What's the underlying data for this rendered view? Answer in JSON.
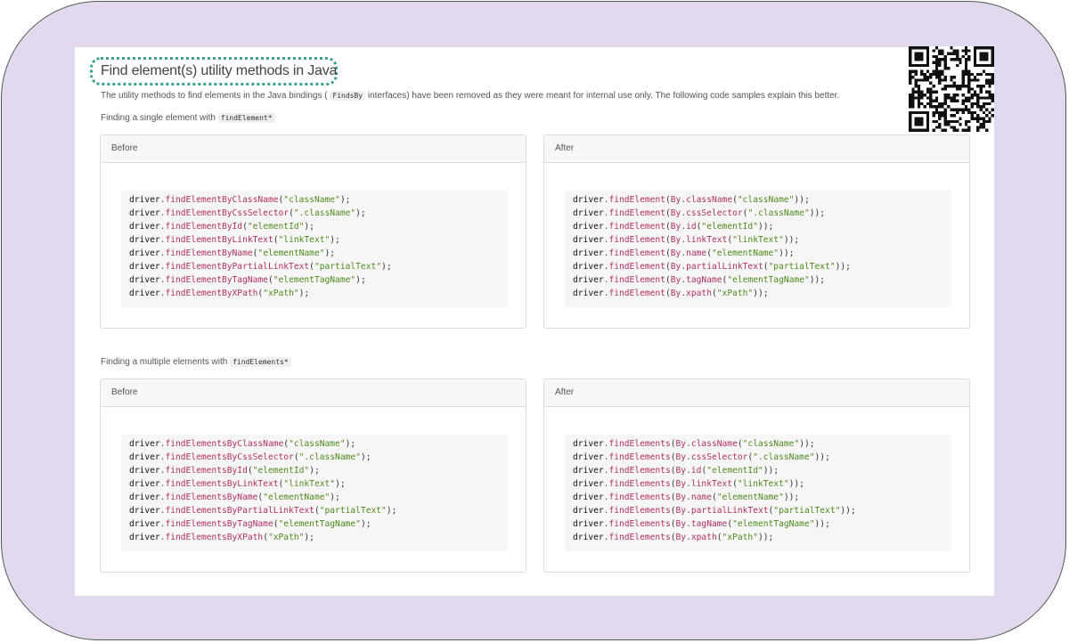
{
  "title": "Find element(s) utility methods in Java",
  "intro": {
    "before": "The utility methods to find elements in the Java bindings (",
    "code": "FindsBy",
    "after": "interfaces) have been removed as they were meant for internal use only. The following code samples explain this better."
  },
  "sections": [
    {
      "heading_text": "Finding a single element with",
      "heading_code": "findElement*",
      "before": {
        "header": "Before",
        "lines": [
          {
            "method": "findElementByClassName",
            "arg": "\"className\"",
            "wrap": ""
          },
          {
            "method": "findElementByCssSelector",
            "arg": "\".className\"",
            "wrap": ""
          },
          {
            "method": "findElementById",
            "arg": "\"elementId\"",
            "wrap": ""
          },
          {
            "method": "findElementByLinkText",
            "arg": "\"linkText\"",
            "wrap": ""
          },
          {
            "method": "findElementByName",
            "arg": "\"elementName\"",
            "wrap": ""
          },
          {
            "method": "findElementByPartialLinkText",
            "arg": "\"partialText\"",
            "wrap": ""
          },
          {
            "method": "findElementByTagName",
            "arg": "\"elementTagName\"",
            "wrap": ""
          },
          {
            "method": "findElementByXPath",
            "arg": "\"xPath\"",
            "wrap": ""
          }
        ]
      },
      "after": {
        "header": "After",
        "lines": [
          {
            "method": "findElement",
            "wrap": "By.className",
            "arg": "\"className\""
          },
          {
            "method": "findElement",
            "wrap": "By.cssSelector",
            "arg": "\".className\""
          },
          {
            "method": "findElement",
            "wrap": "By.id",
            "arg": "\"elementId\""
          },
          {
            "method": "findElement",
            "wrap": "By.linkText",
            "arg": "\"linkText\""
          },
          {
            "method": "findElement",
            "wrap": "By.name",
            "arg": "\"elementName\""
          },
          {
            "method": "findElement",
            "wrap": "By.partialLinkText",
            "arg": "\"partialText\""
          },
          {
            "method": "findElement",
            "wrap": "By.tagName",
            "arg": "\"elementTagName\""
          },
          {
            "method": "findElement",
            "wrap": "By.xpath",
            "arg": "\"xPath\""
          }
        ]
      }
    },
    {
      "heading_text": "Finding a multiple elements with",
      "heading_code": "findElements*",
      "before": {
        "header": "Before",
        "lines": [
          {
            "method": "findElementsByClassName",
            "arg": "\"className\"",
            "wrap": ""
          },
          {
            "method": "findElementsByCssSelector",
            "arg": "\".className\"",
            "wrap": ""
          },
          {
            "method": "findElementsById",
            "arg": "\"elementId\"",
            "wrap": ""
          },
          {
            "method": "findElementsByLinkText",
            "arg": "\"linkText\"",
            "wrap": ""
          },
          {
            "method": "findElementsByName",
            "arg": "\"elementName\"",
            "wrap": ""
          },
          {
            "method": "findElementsByPartialLinkText",
            "arg": "\"partialText\"",
            "wrap": ""
          },
          {
            "method": "findElementsByTagName",
            "arg": "\"elementTagName\"",
            "wrap": ""
          },
          {
            "method": "findElementsByXPath",
            "arg": "\"xPath\"",
            "wrap": ""
          }
        ]
      },
      "after": {
        "header": "After",
        "lines": [
          {
            "method": "findElements",
            "wrap": "By.className",
            "arg": "\"className\""
          },
          {
            "method": "findElements",
            "wrap": "By.cssSelector",
            "arg": "\".className\""
          },
          {
            "method": "findElements",
            "wrap": "By.id",
            "arg": "\"elementId\""
          },
          {
            "method": "findElements",
            "wrap": "By.linkText",
            "arg": "\"linkText\""
          },
          {
            "method": "findElements",
            "wrap": "By.name",
            "arg": "\"elementName\""
          },
          {
            "method": "findElements",
            "wrap": "By.partialLinkText",
            "arg": "\"partialText\""
          },
          {
            "method": "findElements",
            "wrap": "By.tagName",
            "arg": "\"elementTagName\""
          },
          {
            "method": "findElements",
            "wrap": "By.xpath",
            "arg": "\"xPath\""
          }
        ]
      }
    }
  ],
  "code_object": "driver",
  "colors": {
    "frame_bg": "#e3d9ee",
    "title_highlight": "#3aa38b",
    "method": "#b03060",
    "string": "#4d8a1c"
  },
  "icons": {
    "qr": "qr-code-icon"
  }
}
